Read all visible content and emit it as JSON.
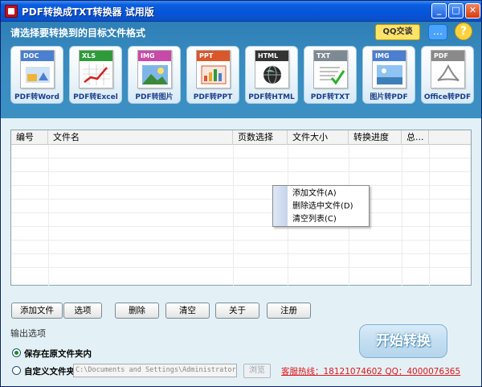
{
  "window": {
    "title": "PDF转换成TXT转换器 试用版"
  },
  "header": {
    "prompt": "请选择要转换到的目标文件格式",
    "qq_button": "QQ交谈"
  },
  "formats": [
    {
      "tag": "DOC",
      "label": "PDF转Word",
      "color": "#4a7fd1"
    },
    {
      "tag": "XLS",
      "label": "PDF转Excel",
      "color": "#2e9b3a"
    },
    {
      "tag": "IMG",
      "label": "PDF转图片",
      "color": "#c84aa8"
    },
    {
      "tag": "PPT",
      "label": "PDF转PPT",
      "color": "#d9572b"
    },
    {
      "tag": "HTML",
      "label": "PDF转HTML",
      "color": "#333333"
    },
    {
      "tag": "TXT",
      "label": "PDF转TXT",
      "color": "#7d8a93"
    },
    {
      "tag": "IMG",
      "label": "图片转PDF",
      "color": "#4a7fd1"
    },
    {
      "tag": "PDF",
      "label": "Office转PDF",
      "color": "#8a8a8a"
    }
  ],
  "table": {
    "columns": [
      "编号",
      "文件名",
      "页数选择",
      "文件大小",
      "转换进度",
      "总..."
    ]
  },
  "context_menu": {
    "items": [
      "添加文件(A)",
      "删除选中文件(D)",
      "清空列表(C)"
    ]
  },
  "buttons": {
    "add": "添加文件",
    "options": "选项",
    "delete": "删除",
    "clear": "清空",
    "about": "关于",
    "register": "注册"
  },
  "output": {
    "title": "输出选项",
    "option_original": "保存在原文件夹内",
    "option_custom": "自定义文件夹",
    "path_value": "C:\\Documents and Settings\\Administrator\\桌面",
    "browse": "浏览",
    "selected": "original"
  },
  "start_button": "开始转换",
  "hotline": "客服热线：18121074602 QQ：4000076365"
}
